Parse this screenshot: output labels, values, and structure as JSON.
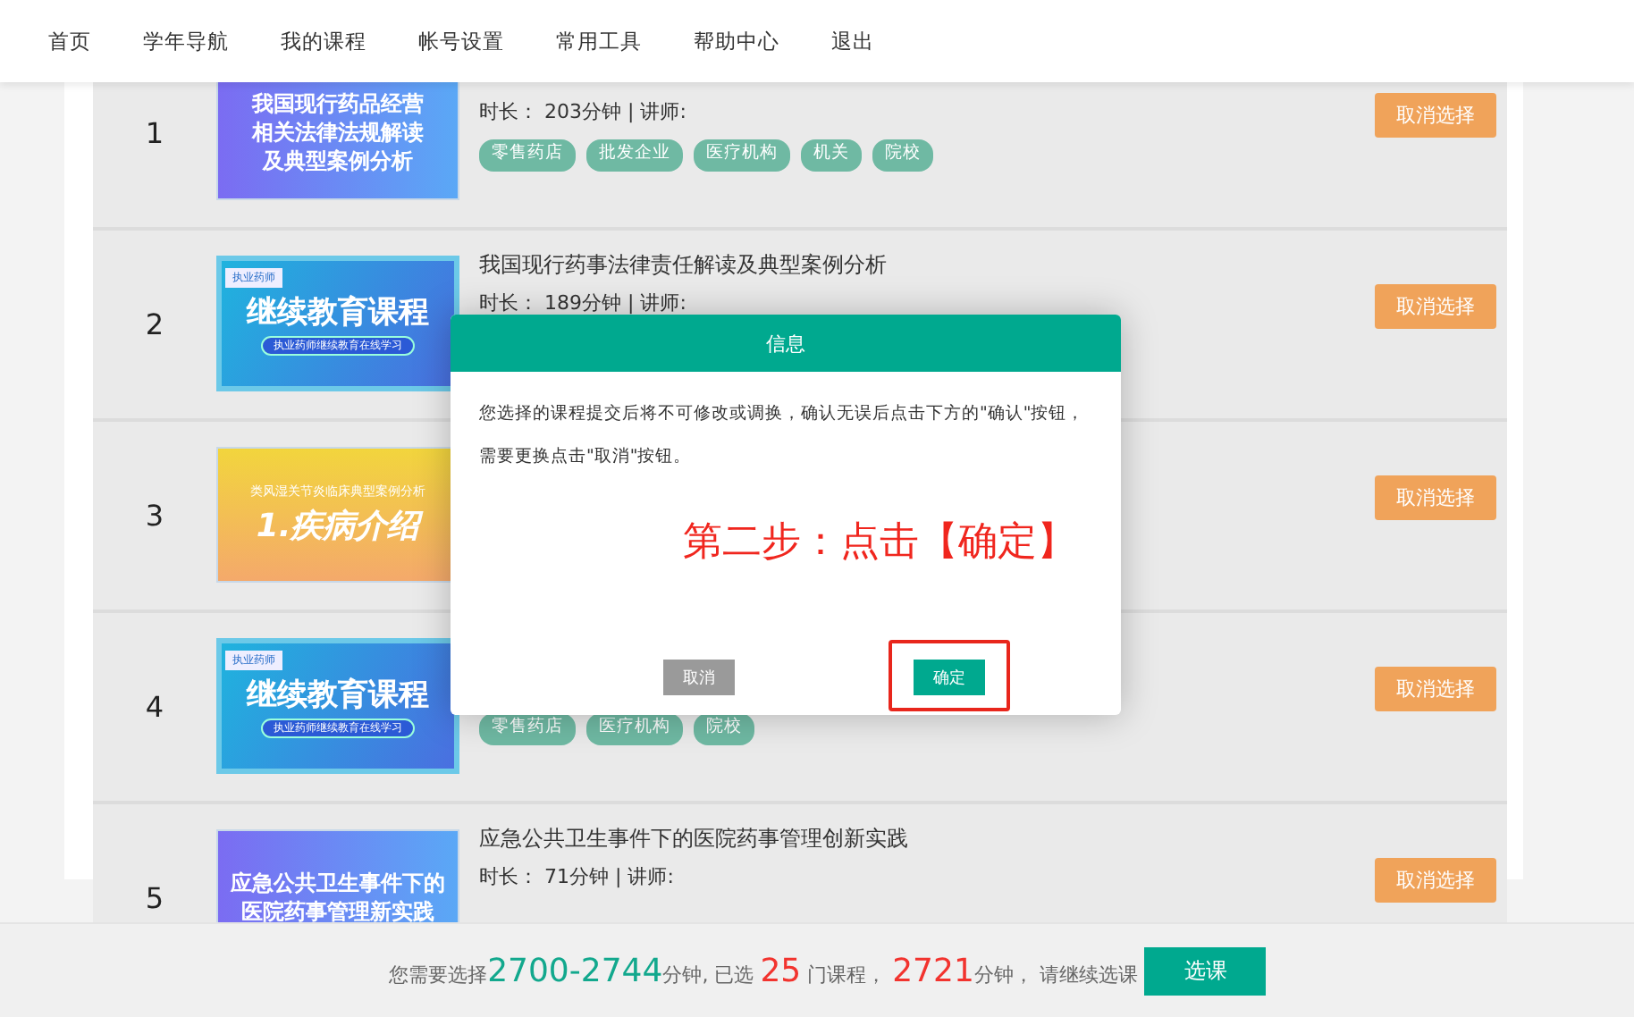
{
  "nav": [
    "首页",
    "学年导航",
    "我的课程",
    "帐号设置",
    "常用工具",
    "帮助中心",
    "退出"
  ],
  "courses": [
    {
      "number": "1",
      "thumb": {
        "kind": "violet",
        "lines": [
          "我国现行药品经营",
          "相关法律法规解读",
          "及典型案例分析"
        ]
      },
      "duration": "时长：  203分钟 | 讲师:",
      "tags": [
        "零售药店",
        "批发企业",
        "医疗机构",
        "机关",
        "院校"
      ],
      "action": "取消选择"
    },
    {
      "number": "2",
      "thumb": {
        "kind": "blue",
        "badge": "执业药师",
        "lines": [
          "继续教育课程"
        ],
        "subtitle": "执业药师继续教育在线学习"
      },
      "title": "我国现行药事法律责任解读及典型案例分析",
      "duration": "时长：  189分钟 | 讲师:",
      "action": "取消选择"
    },
    {
      "number": "3",
      "thumb": {
        "kind": "yellow",
        "subtitle": "类风湿关节炎临床典型案例分析",
        "lines": [
          "1.疾病介绍"
        ]
      },
      "action": "取消选择"
    },
    {
      "number": "4",
      "thumb": {
        "kind": "blue",
        "badge": "执业药师",
        "lines": [
          "继续教育课程"
        ],
        "subtitle": "执业药师继续教育在线学习"
      },
      "tags": [
        "零售药店",
        "医疗机构",
        "院校"
      ],
      "action": "取消选择"
    },
    {
      "number": "5",
      "thumb": {
        "kind": "violet",
        "lines": [
          "应急公共卫生事件下的",
          "医院药事管理新实践"
        ]
      },
      "title": "应急公共卫生事件下的医院药事管理创新实践",
      "duration": "时长：  71分钟 | 讲师:",
      "action": "取消选择"
    }
  ],
  "dialog": {
    "title": "信息",
    "message": "您选择的课程提交后将不可修改或调换，确认无误后点击下方的\"确认\"按钮，需要更换点击\"取消\"按钮。",
    "annotation": "第二步：点击【确定】",
    "buttons": [
      {
        "label": "取消",
        "kind": "secondary",
        "highlighted": false
      },
      {
        "label": "确定",
        "kind": "primary",
        "highlighted": true
      }
    ]
  },
  "summary": {
    "segments": [
      {
        "text": "您需要选择",
        "kind": "plain"
      },
      {
        "text": "2700-2744",
        "kind": "green"
      },
      {
        "text": "分钟, 已选 ",
        "kind": "plain"
      },
      {
        "text": "25",
        "kind": "red"
      },
      {
        "text": " 门课程， ",
        "kind": "plain"
      },
      {
        "text": "2721",
        "kind": "red"
      },
      {
        "text": "分钟， 请继续选课",
        "kind": "plain"
      }
    ],
    "button": "选课"
  }
}
